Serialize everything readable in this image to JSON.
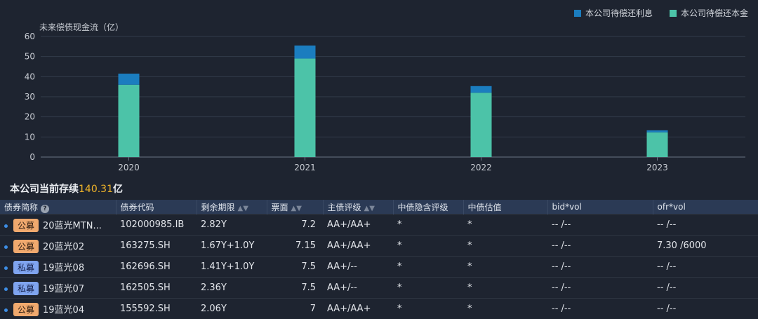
{
  "legend": {
    "interest": {
      "label": "本公司待偿还利息",
      "color": "#1b7dbf"
    },
    "principal": {
      "label": "本公司待偿还本金",
      "color": "#4cc3a8"
    }
  },
  "chart_data": {
    "type": "bar",
    "stacked": true,
    "title": "",
    "ylabel": "未来偿债现金流（亿）",
    "xlabel": "",
    "ylim": [
      0,
      60
    ],
    "yticks": [
      0,
      10,
      20,
      30,
      40,
      50,
      60
    ],
    "categories": [
      "2020",
      "2021",
      "2022",
      "2023"
    ],
    "series": [
      {
        "name": "本公司待偿还本金",
        "values": [
          36,
          49,
          32,
          12.3
        ]
      },
      {
        "name": "本公司待偿还利息",
        "values": [
          5.5,
          6.5,
          3.3,
          1.0
        ]
      }
    ],
    "grid": true,
    "legend_position": "top-right"
  },
  "summary": {
    "prefix": "本公司当前存续",
    "amount": "140.31",
    "unit": "亿"
  },
  "table": {
    "headers": [
      "债券简称",
      "债券代码",
      "剩余期限",
      "票面",
      "主债评级",
      "中债隐含评级",
      "中债估值",
      "bid*vol",
      "ofr*vol"
    ],
    "rows": [
      {
        "tag": "公募",
        "tag_type": "pub",
        "name": "20蓝光MTN...",
        "code": "102000985.IB",
        "term": "2.82Y",
        "coupon": "7.2",
        "rating": "AA+/AA+",
        "implied": "*",
        "valuation": "*",
        "bid": "-- /--",
        "ofr": "-- /--"
      },
      {
        "tag": "公募",
        "tag_type": "pub",
        "name": "20蓝光02",
        "code": "163275.SH",
        "term": "1.67Y+1.0Y",
        "coupon": "7.15",
        "rating": "AA+/AA+",
        "implied": "*",
        "valuation": "*",
        "bid": "-- /--",
        "ofr": "7.30 /6000"
      },
      {
        "tag": "私募",
        "tag_type": "priv",
        "name": "19蓝光08",
        "code": "162696.SH",
        "term": "1.41Y+1.0Y",
        "coupon": "7.5",
        "rating": "AA+/--",
        "implied": "*",
        "valuation": "*",
        "bid": "-- /--",
        "ofr": "-- /--"
      },
      {
        "tag": "私募",
        "tag_type": "priv",
        "name": "19蓝光07",
        "code": "162505.SH",
        "term": "2.36Y",
        "coupon": "7.5",
        "rating": "AA+/--",
        "implied": "*",
        "valuation": "*",
        "bid": "-- /--",
        "ofr": "-- /--"
      },
      {
        "tag": "公募",
        "tag_type": "pub",
        "name": "19蓝光04",
        "code": "155592.SH",
        "term": "2.06Y",
        "coupon": "7",
        "rating": "AA+/AA+",
        "implied": "*",
        "valuation": "*",
        "bid": "-- /--",
        "ofr": "-- /--"
      }
    ]
  }
}
